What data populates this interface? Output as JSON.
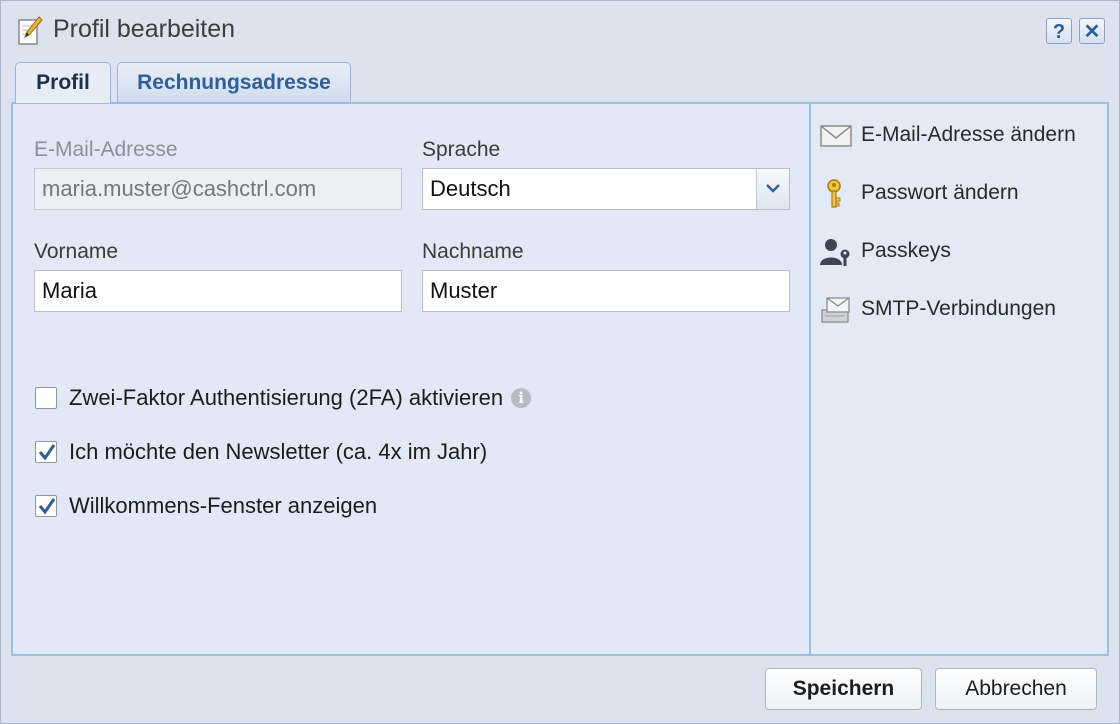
{
  "window": {
    "title": "Profil bearbeiten",
    "help_label": "?",
    "close_label": "✕"
  },
  "tabs": [
    {
      "label": "Profil",
      "active": true
    },
    {
      "label": "Rechnungsadresse",
      "active": false
    }
  ],
  "form": {
    "email": {
      "label": "E-Mail-Adresse",
      "value": "maria.muster@cashctrl.com",
      "disabled": true
    },
    "language": {
      "label": "Sprache",
      "value": "Deutsch"
    },
    "firstname": {
      "label": "Vorname",
      "value": "Maria"
    },
    "lastname": {
      "label": "Nachname",
      "value": "Muster"
    },
    "checkboxes": [
      {
        "label": "Zwei-Faktor Authentisierung (2FA) aktivieren",
        "checked": false,
        "info": "i"
      },
      {
        "label": "Ich möchte den Newsletter (ca. 4x im Jahr)",
        "checked": true
      },
      {
        "label": "Willkommens-Fenster anzeigen",
        "checked": true
      }
    ]
  },
  "side_actions": [
    {
      "label": "E-Mail-Adresse ändern",
      "icon": "envelope-icon"
    },
    {
      "label": "Passwort ändern",
      "icon": "key-icon"
    },
    {
      "label": "Passkeys",
      "icon": "user-key-icon"
    },
    {
      "label": "SMTP-Verbindungen",
      "icon": "mail-server-icon"
    }
  ],
  "buttons": {
    "save": "Speichern",
    "cancel": "Abbrechen"
  },
  "colors": {
    "accent": "#2e5f96",
    "panel_border": "#9fbde3",
    "background": "#dde3ee"
  }
}
